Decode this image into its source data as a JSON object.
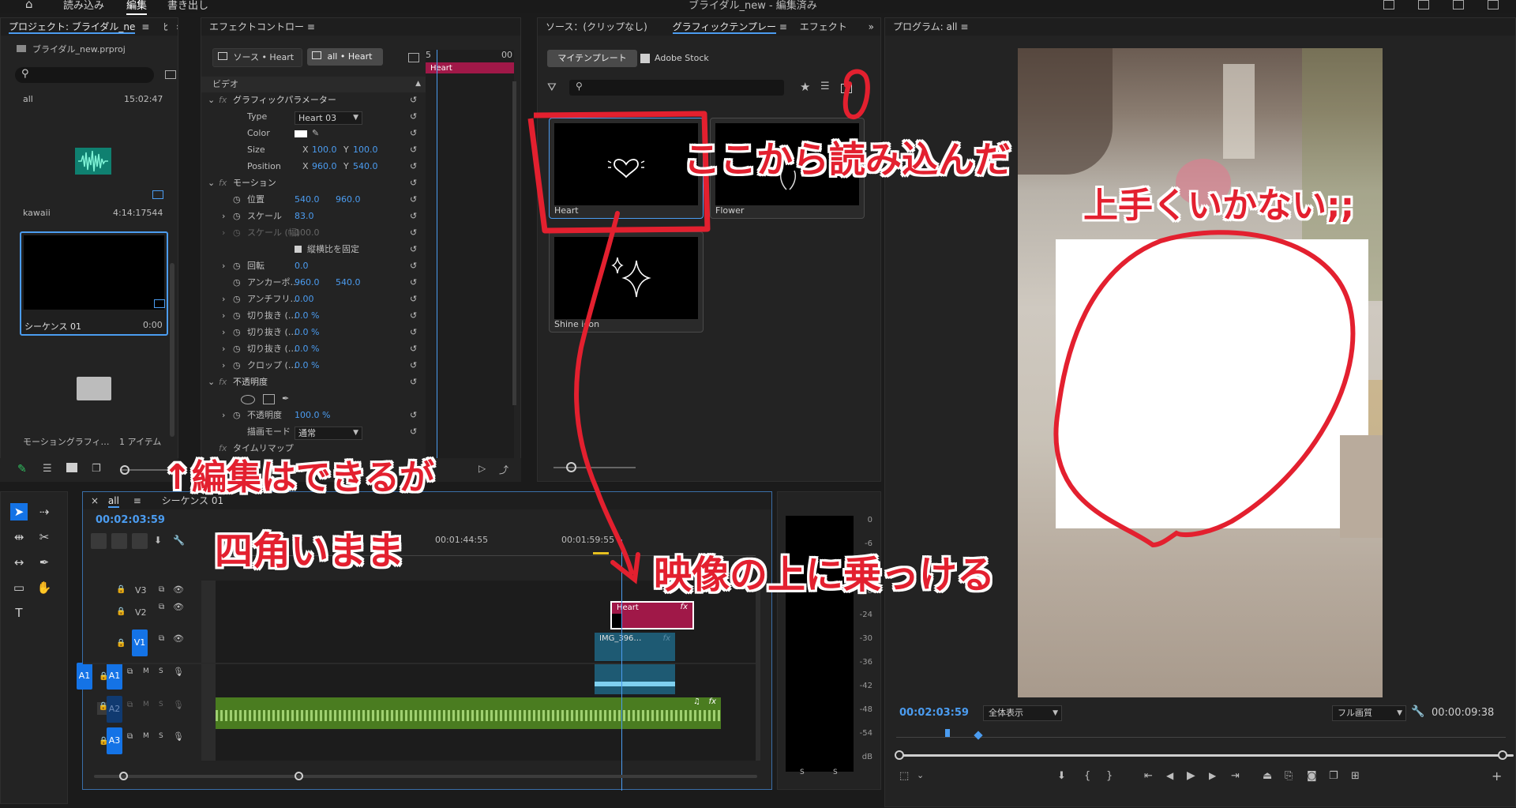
{
  "topbar": {
    "home": "⌂",
    "tabs": [
      "読み込み",
      "編集",
      "書き出し"
    ],
    "active_tab": "編集",
    "doc_title": "ブライダル_new - 編集済み"
  },
  "project": {
    "title": "プロジェクト: ブライダル_ne",
    "tab2": "ﾋ",
    "file": "ブライダル_new.prproj",
    "items": [
      {
        "name": "all",
        "duration": "15:02:47"
      },
      {
        "name": "kawaii",
        "duration": "4:14:17544"
      },
      {
        "name": "シーケンス 01",
        "duration": "0:00"
      },
      {
        "name": "モーショングラフィ…",
        "duration": "1 アイテム"
      }
    ]
  },
  "effects": {
    "title": "エフェクトコントロー",
    "source_tab": "ソース • Heart",
    "seq_tab": "all • Heart",
    "section_video": "ビデオ",
    "clip_label": "Heart",
    "mini_time": "00",
    "rows": {
      "graphic": "グラフィックパラメーター",
      "type": "Type",
      "type_val": "Heart 03",
      "color": "Color",
      "size": "Size",
      "size_x": "100.0",
      "size_y": "100.0",
      "position": "Position",
      "pos_x": "960.0",
      "pos_y": "540.0",
      "motion": "モーション",
      "pos_jp": "位置",
      "pos_jp_x": "540.0",
      "pos_jp_y": "960.0",
      "scale": "スケール",
      "scale_v": "83.0",
      "scale_w": "スケール (幅)",
      "scale_w_v": "100.0",
      "lock": "縦横比を固定",
      "rotate": "回転",
      "rotate_v": "0.0",
      "anchor": "アンカーポ…",
      "anchor_x": "960.0",
      "anchor_y": "540.0",
      "antiflicker": "アンチフリ…",
      "antiflicker_v": "0.00",
      "crop1": "切り抜き (…",
      "crop1_v": "0.0 %",
      "crop2": "切り抜き (…",
      "crop2_v": "0.0 %",
      "crop3": "切り抜き (…",
      "crop3_v": "0.0 %",
      "crop4": "クロップ (…",
      "crop4_v": "0.0 %",
      "opacity": "不透明度",
      "opacity_v_label": "不透明度",
      "opacity_v": "100.0 %",
      "blend": "描画モード",
      "blend_v": "通常",
      "remap": "タイムリマップ"
    }
  },
  "graphics": {
    "tabs": [
      "ソース：(クリップなし)",
      "グラフィックテンプレー",
      "エフェクト"
    ],
    "active": "グラフィックテンプレー",
    "sub_tabs": [
      "マイテンプレート",
      "Adobe Stock"
    ],
    "search_placeholder": "",
    "templates": [
      "Heart",
      "Flower",
      "Shine icon"
    ]
  },
  "program": {
    "title": "プログラム: all",
    "timecode": "00:02:03:59",
    "fit": "全体表示",
    "quality": "フル画質",
    "duration": "00:00:09:38"
  },
  "timeline": {
    "tabs": [
      "all",
      "シーケンス 01"
    ],
    "timecode": "00:02:03:59",
    "ruler": [
      "00:01:44:55",
      "00:01:59:55"
    ],
    "tracks": [
      "V3",
      "V2",
      "V1",
      "A1",
      "A2",
      "A3"
    ],
    "src_v1": "V1",
    "src_a1": "A1",
    "clips": {
      "heart": "Heart",
      "img": "IMG_396…"
    },
    "audio_btns": [
      "M",
      "S"
    ]
  },
  "meter": {
    "labels": [
      "0",
      "-6",
      "-12",
      "-18",
      "-24",
      "-30",
      "-36",
      "-42",
      "-48",
      "-54",
      "dB"
    ],
    "bottom": [
      "S",
      "S"
    ]
  },
  "annotations": {
    "load": "ここから読み込んだ",
    "fail": "上手くいかない;;",
    "edit": "↑編集はできるが",
    "square": "四角いまま",
    "overlay": "映像の上に乗っける"
  },
  "colors": {
    "accent": "#4b9cf0",
    "track_blue": "#1473e6",
    "clip_pink": "#a01848",
    "clip_teal": "#1e5a73",
    "audio_green": "#4a7c20",
    "annotation_red": "#e3202f"
  }
}
